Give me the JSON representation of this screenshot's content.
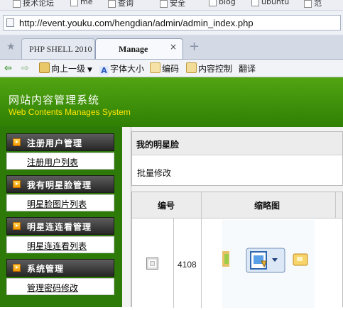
{
  "bookmarks": [
    "技术论坛",
    "me",
    "查询",
    "安全",
    "blog",
    "ubuntu",
    "范"
  ],
  "browser": {
    "url": "http://event.youku.com/hengdian/admin/admin_index.php",
    "tabs": [
      {
        "label": "PHP SHELL 2010",
        "active": false
      },
      {
        "label": "Manage",
        "active": true
      }
    ],
    "tab_close": "×",
    "new_tab": "+"
  },
  "commandbar": {
    "up": "向上一级",
    "font_size": "字体大小",
    "encoding": "编码",
    "content_control": "内容控制",
    "translate": "翻译"
  },
  "banner": {
    "title_cn": "网站内容管理系统",
    "title_en": "Web Contents Manages System"
  },
  "sidebar": {
    "sections": [
      {
        "title": "注册用户管理",
        "link": "注册用户列表"
      },
      {
        "title": "我有明星脸管理",
        "link": "明星脸图片列表"
      },
      {
        "title": "明星连连看管理",
        "link": "明星连连看列表"
      },
      {
        "title": "系统管理",
        "link": "管理密码修改"
      }
    ]
  },
  "main": {
    "panel_title": "我的明星脸",
    "batch_edit": "批量修改",
    "table": {
      "headers": [
        "编号",
        "缩略图"
      ],
      "rows": [
        {
          "id": "4108"
        }
      ]
    }
  },
  "colors": {
    "banner_green": "#3f9208",
    "banner_subtitle": "#ffe600",
    "sidebar_header": "#3a3a3a"
  }
}
